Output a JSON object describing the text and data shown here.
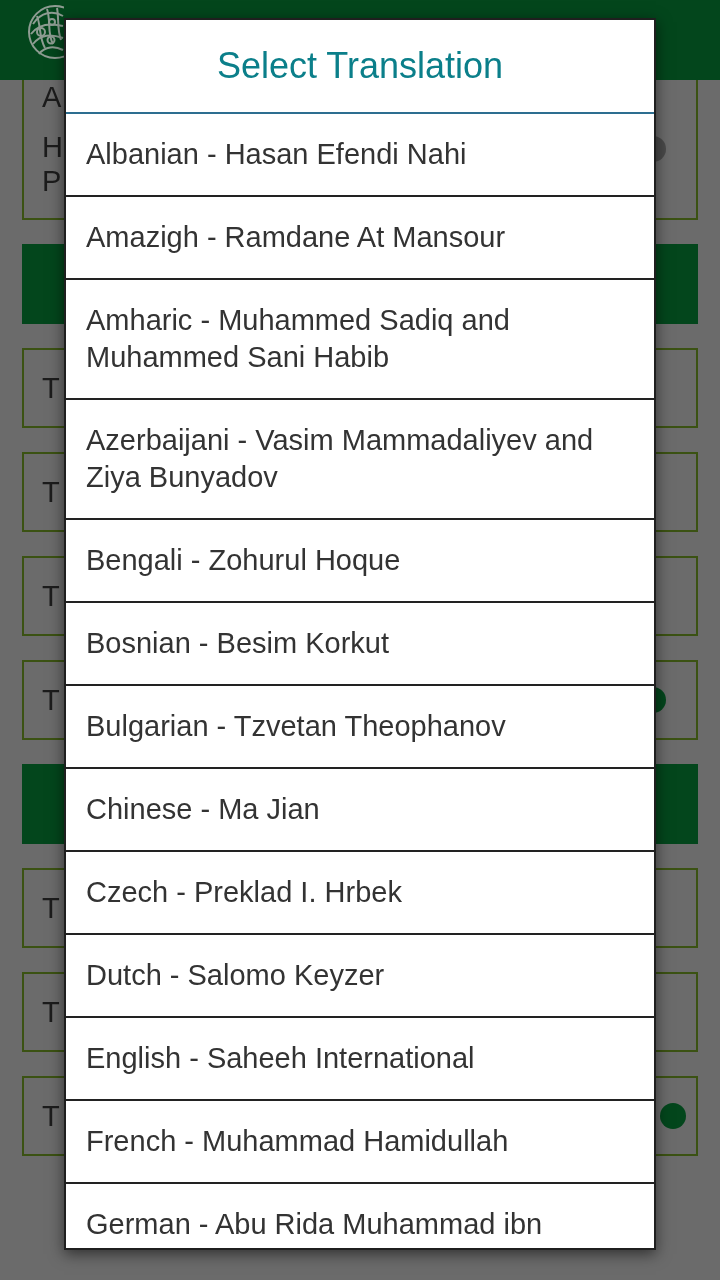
{
  "settings": [
    {
      "kind": "card",
      "texts": [
        "A",
        "H",
        "P"
      ],
      "indicator": {
        "kind": "radio",
        "on": false
      }
    },
    {
      "kind": "header"
    },
    {
      "kind": "card",
      "texts": [
        "T"
      ]
    },
    {
      "kind": "card",
      "texts": [
        "T"
      ]
    },
    {
      "kind": "card",
      "texts": [
        "T"
      ]
    },
    {
      "kind": "card",
      "texts": [
        "T"
      ],
      "indicator": {
        "kind": "radio",
        "on": true
      }
    },
    {
      "kind": "header"
    },
    {
      "kind": "card",
      "texts": [
        "T"
      ]
    },
    {
      "kind": "card",
      "texts": [
        "T"
      ]
    },
    {
      "kind": "card",
      "texts": [
        "T"
      ],
      "indicator": {
        "kind": "dot",
        "on": true
      }
    }
  ],
  "dialog": {
    "title": "Select Translation",
    "options": [
      {
        "label": "Albanian - Hasan Efendi Nahi"
      },
      {
        "label": "Amazigh - Ramdane At Mansour"
      },
      {
        "label": "Amharic - Muhammed Sadiq and Muhammed Sani Habib"
      },
      {
        "label": "Azerbaijani - Vasim Mammadaliyev and Ziya Bunyadov"
      },
      {
        "label": "Bengali - Zohurul Hoque"
      },
      {
        "label": "Bosnian - Besim Korkut"
      },
      {
        "label": "Bulgarian - Tzvetan Theophanov"
      },
      {
        "label": "Chinese - Ma Jian"
      },
      {
        "label": "Czech - Preklad I. Hrbek"
      },
      {
        "label": "Dutch - Salomo Keyzer"
      },
      {
        "label": "English - Saheeh International"
      },
      {
        "label": "French - Muhammad Hamidullah"
      },
      {
        "label": "German - Abu Rida Muhammad ibn"
      }
    ]
  }
}
